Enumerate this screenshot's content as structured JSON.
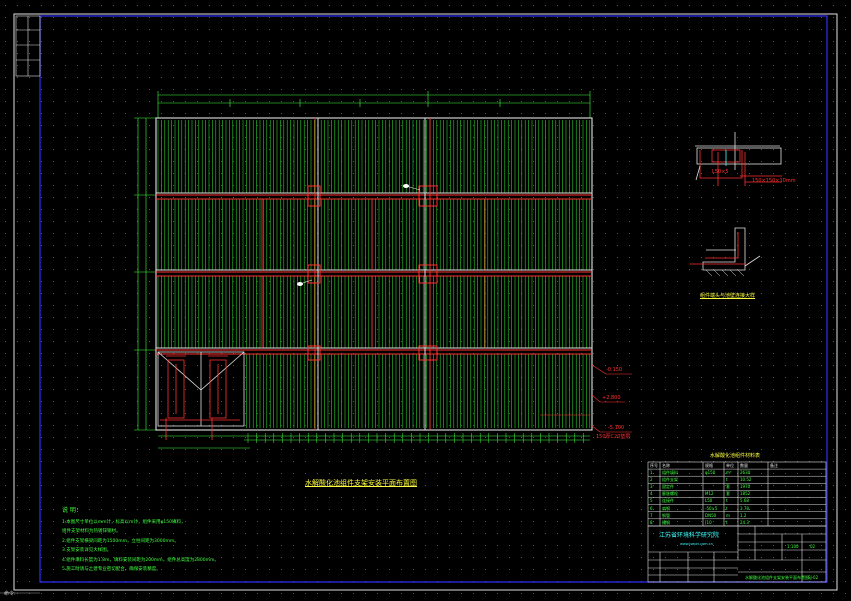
{
  "drawing": {
    "title": "水解酸化池组件支架安装平面布置图",
    "detail_caption": "组件端头与池壁连接大样",
    "company": "江苏省环境科学研究院",
    "company_url": "www.jsepri.com.cn",
    "notes_heading": "说 明：",
    "notes": [
      "1.本图尺寸单位以mm计，标高以m计，组件采用φ150填料，",
      "  组件支架材料为热镀锌钢材。",
      "2.组件支架横梁间距为1500mm，立柱间距为3000mm。",
      "3.支架安装详见大样图。",
      "4.组件填料长度为1.8m，填料安装间距为200mm，组件总高度为2800mm。",
      "5.施工时请与土建专业密切配合，确保安装精度。"
    ],
    "bom_title": "水解酸化池组件材料表",
    "bom_headers": [
      "序号",
      "名称",
      "规格",
      "单位",
      "数量",
      "备注"
    ],
    "bom_rows": [
      [
        "1",
        "组件填料",
        "φ150",
        "m³",
        "2630",
        ""
      ],
      [
        "2",
        "组件支架",
        "",
        "t",
        "10.52",
        ""
      ],
      [
        "3",
        "固定件",
        "",
        "套",
        "1970",
        ""
      ],
      [
        "4",
        "膨胀螺栓",
        "M12",
        "套",
        "1852",
        ""
      ],
      [
        "5",
        "连接件",
        "L50",
        "t",
        "5.68",
        ""
      ],
      [
        "6",
        "扁钢",
        "-50×5",
        "t",
        "3.78",
        ""
      ],
      [
        "7",
        "钢管",
        "DN50",
        "m",
        "1.2",
        ""
      ],
      [
        "8",
        "槽钢",
        "[10",
        "t",
        "24.3",
        ""
      ]
    ],
    "title_block": {
      "drawing_name": "水解酸化池组件支架安装平面布置图",
      "scale": "1:100",
      "drawing_no": "SJ-02",
      "sheet": "02"
    },
    "label_elev_a": "-0.150",
    "label_elev_b": "+2.800",
    "label_elev_c": "-5.100",
    "label_elev_d": "150厚C20垫层",
    "label_detail_a": "L50×5",
    "label_detail_b": "150×150×10mm",
    "cad_info": "命令:"
  }
}
